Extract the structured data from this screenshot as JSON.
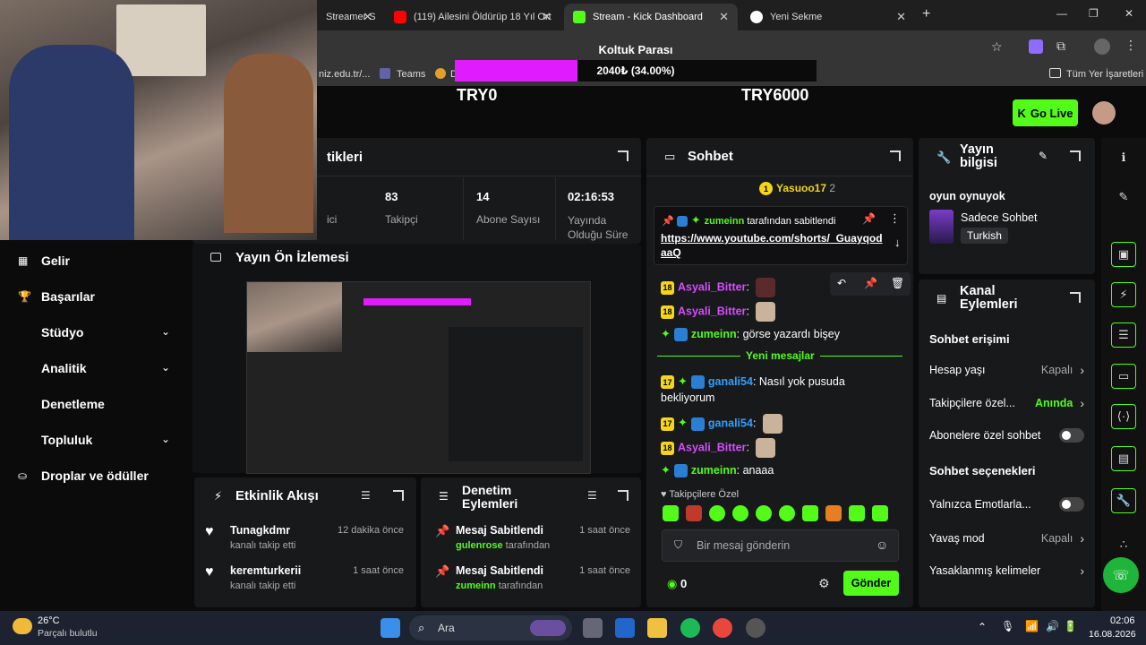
{
  "browser": {
    "tabs": [
      {
        "title": "Streamer S"
      },
      {
        "title": "(119) Ailesini Öldürüp 18 Yıl Ort"
      },
      {
        "title": "Stream - Kick Dashboard"
      },
      {
        "title": "Yeni Sekme"
      }
    ],
    "new_tab": "+",
    "bookmarks": [
      "niz.edu.tr/...",
      "Teams",
      "D"
    ],
    "all_bookmarks": "Tüm Yer İşaretleri"
  },
  "goal": {
    "title": "Koltuk Parası",
    "progress_text": "2040₺ (34.00%)",
    "progress": 0.34,
    "min": "TRY0",
    "max": "TRY6000",
    "color": "#e01cff"
  },
  "header": {
    "go_live": "Go Live"
  },
  "stats": {
    "title_fragment": "tikleri",
    "items": [
      {
        "value": "",
        "label": "ici"
      },
      {
        "value": "83",
        "label": "Takipçi"
      },
      {
        "value": "14",
        "label": "Abone Sayısı"
      },
      {
        "value": "02:16:53",
        "label": "Yayında Olduğu Süre"
      }
    ]
  },
  "overlay_menu": {
    "items": [
      "Gelir",
      "Başarılar",
      "Stüdyo",
      "Analitik",
      "Denetleme",
      "Topluluk",
      "Droplar ve ödüller"
    ],
    "preview_title": "Yayın Ön İzlemesi"
  },
  "chat": {
    "title": "Sohbet",
    "top_user": "Yasuoo17",
    "top_user_badge": "2",
    "pinned": {
      "by_user": "zumeinn",
      "by_text": "tarafından sabitlendi",
      "link": "https://www.youtube.com/shorts/_GuayqodaaQ"
    },
    "messages": [
      {
        "badge": "18",
        "user": "Asyali_Bitter",
        "text": "",
        "user_color": "#d64bff"
      },
      {
        "badge": "18",
        "user": "Asyali_Bitter",
        "text": "",
        "user_color": "#d64bff"
      },
      {
        "badge": "",
        "user": "zumeinn",
        "text": "görse yazardı bişey",
        "user_color": "#53fc18"
      }
    ],
    "new_messages": "Yeni mesajlar",
    "messages2": [
      {
        "badge": "17",
        "user": "ganali54",
        "text": "Nasıl yok pusuda bekliyorum",
        "user_color": "#2fa0ff"
      },
      {
        "badge": "17",
        "user": "ganali54",
        "text": "",
        "user_color": "#2fa0ff"
      },
      {
        "badge": "18",
        "user": "Asyali_Bitter",
        "text": "",
        "user_color": "#d64bff"
      },
      {
        "badge": "",
        "user": "zumeinn",
        "text": "anaaa",
        "user_color": "#53fc18"
      }
    ],
    "followers_only": "Takipçilere Özel",
    "input_placeholder": "Bir mesaj gönderin",
    "points": "0",
    "send": "Gönder"
  },
  "stream_info": {
    "title": "Yayın bilgisi",
    "subtitle": "oyun oynuyok",
    "category": "Sadece Sohbet",
    "language": "Turkish"
  },
  "channel_actions": {
    "title": "Kanal Eylemleri",
    "chat_access": "Sohbet erişimi",
    "rows1": [
      {
        "label": "Hesap yaşı",
        "value": "Kapalı"
      },
      {
        "label": "Takipçilere özel...",
        "value": "Anında"
      },
      {
        "label": "Abonelere özel sohbet",
        "value": ""
      }
    ],
    "chat_options": "Sohbet seçenekleri",
    "rows2": [
      {
        "label": "Yalnızca Emotlarla...",
        "value": ""
      },
      {
        "label": "Yavaş mod",
        "value": "Kapalı"
      },
      {
        "label": "Yasaklanmış kelimeler",
        "value": ""
      }
    ]
  },
  "activity": {
    "title": "Etkinlik Akışı",
    "items": [
      {
        "user": "Tunagkdmr",
        "action": "kanalı takip etti",
        "time": "12 dakika önce"
      },
      {
        "user": "keremturkerii",
        "action": "kanalı takip etti",
        "time": "1 saat önce"
      }
    ]
  },
  "moderation": {
    "title": "Denetim Eylemleri",
    "items": [
      {
        "title": "Mesaj Sabitlendi",
        "user": "gulenrose",
        "suffix": "tarafından",
        "time": "1 saat önce"
      },
      {
        "title": "Mesaj Sabitlendi",
        "user": "zumeinn",
        "suffix": "tarafından",
        "time": "1 saat önce"
      }
    ]
  },
  "taskbar": {
    "temp": "26°C",
    "weather": "Parçalı bulutlu",
    "search": "Ara",
    "time": "02:06",
    "date": "16.08.2026"
  },
  "colors": {
    "accent": "#53fc18",
    "bg": "#0b0b0c",
    "panel": "#18191b"
  }
}
